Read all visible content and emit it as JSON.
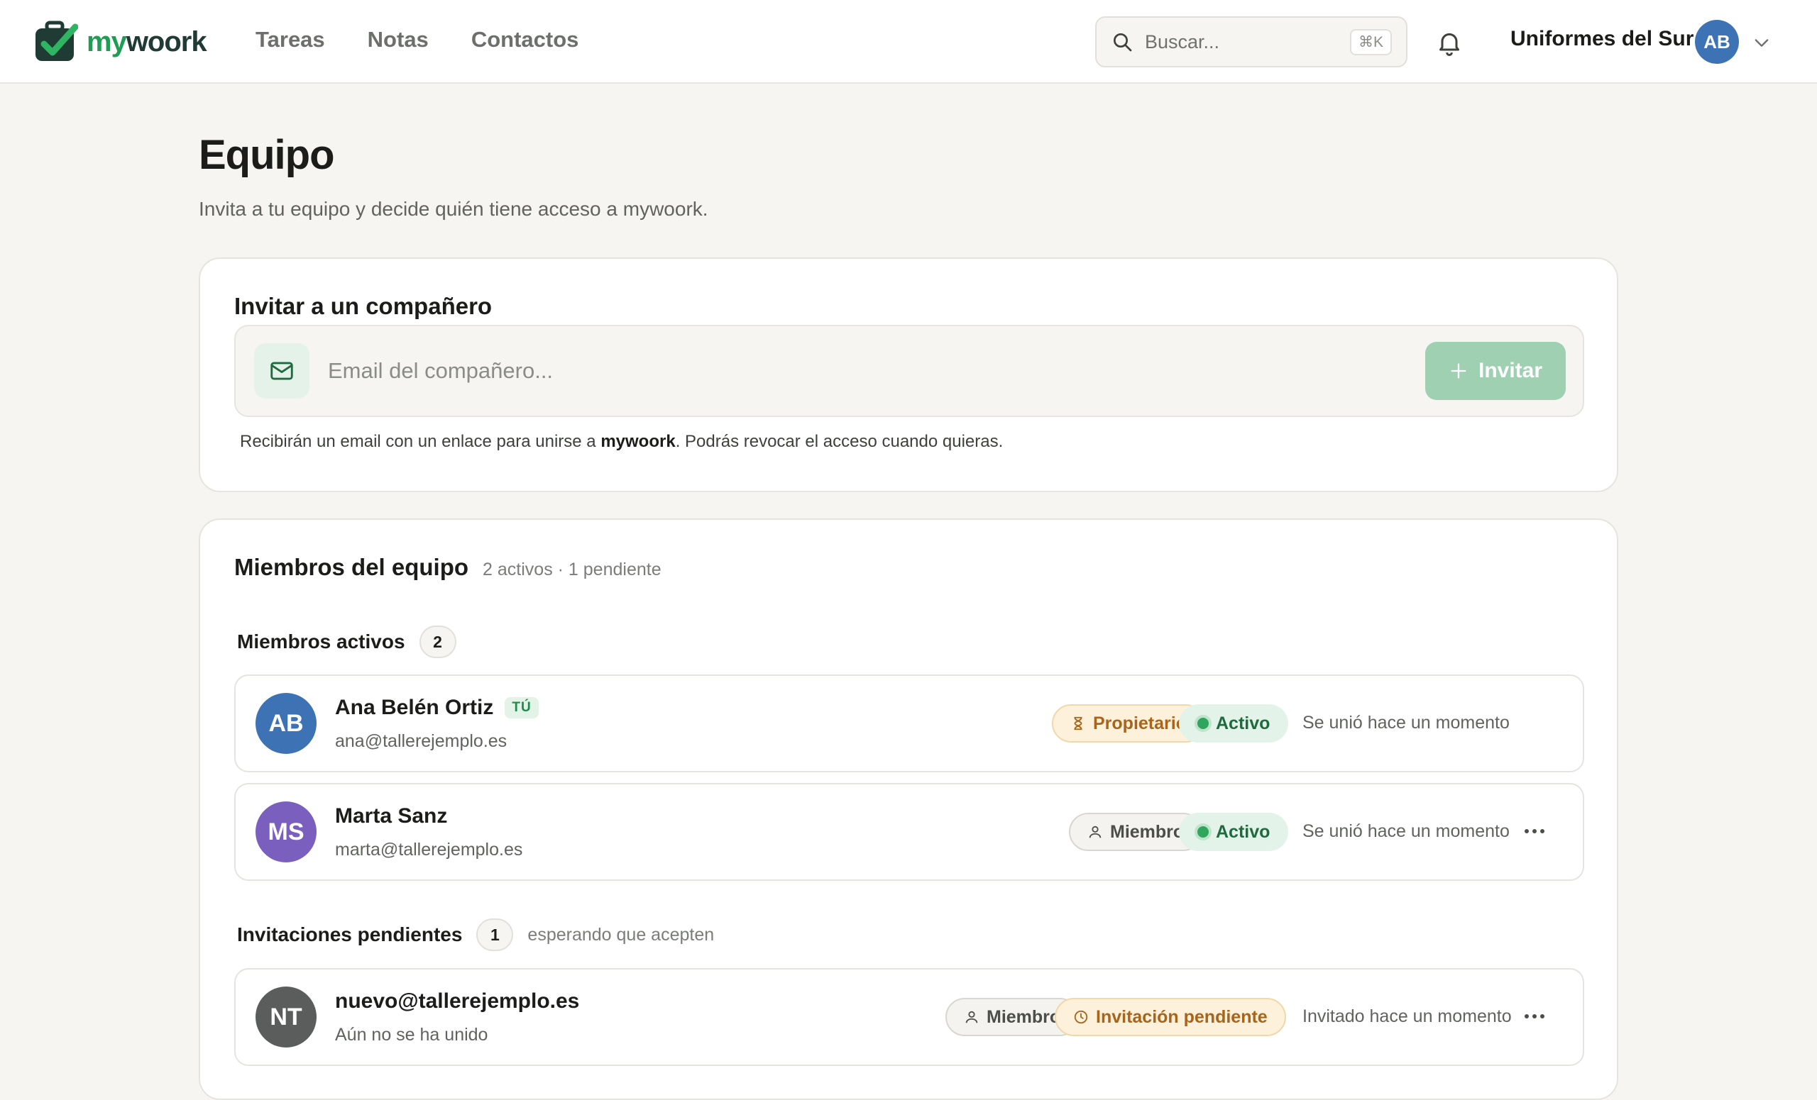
{
  "app": {
    "logo_my": "my",
    "logo_rest": "woork",
    "nav": [
      "Tareas",
      "Notas",
      "Contactos"
    ],
    "search_placeholder": "Buscar...",
    "search_shortcut": "⌘K",
    "org_name": "Uniformes del Sur",
    "user_initials": "AB"
  },
  "page": {
    "title": "Equipo",
    "subtitle": "Invita a tu equipo y decide quién tiene acceso a mywoork."
  },
  "invite": {
    "title": "Invitar a un compañero",
    "email_placeholder": "Email del compañero...",
    "email_value": "",
    "button_label": "Invitar",
    "note_before": "Recibirán un email con un enlace para unirse a ",
    "note_brand": "mywoork",
    "note_after": ". Podrás revocar el acceso cuando quieras."
  },
  "members": {
    "title": "Miembros del equipo",
    "summary": "2 activos · 1 pendiente",
    "active_section": {
      "title": "Miembros activos",
      "count": "2",
      "rows": [
        {
          "initials": "AB",
          "avatar_color": "#3d73b5",
          "name": "Ana Belén Ortiz",
          "you_badge": "TÚ",
          "email": "ana@tallerejemplo.es",
          "role": "Propietario",
          "status": "Activo",
          "joined": "Se unió hace un momento"
        },
        {
          "initials": "MS",
          "avatar_color": "#7a5fbf",
          "name": "Marta Sanz",
          "email": "marta@tallerejemplo.es",
          "role": "Miembro",
          "status": "Activo",
          "joined": "Se unió hace un momento"
        }
      ]
    },
    "pending_section": {
      "title": "Invitaciones pendientes",
      "count": "1",
      "hint": "esperando que acepten",
      "rows": [
        {
          "initials": "NT",
          "avatar_color": "#5a5d5b",
          "email": "nuevo@tallerejemplo.es",
          "state": "Aún no se ha unido",
          "role": "Miembro",
          "status": "Invitación pendiente",
          "invited": "Invitado hace un momento"
        }
      ]
    }
  },
  "colors": {
    "brand_green": "#1f9d55",
    "invite_button": "#9fd0b2",
    "owner_badge": "#a8641a",
    "active_badge": "#1f6b3e"
  }
}
